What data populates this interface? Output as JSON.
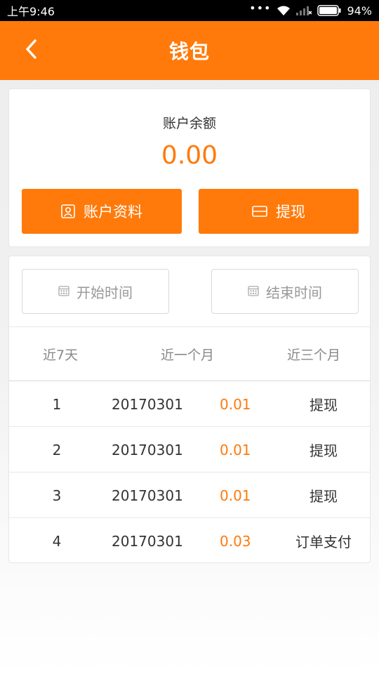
{
  "status_bar": {
    "time": "上午9:46",
    "battery": "94%",
    "icons": [
      "more-dots-icon",
      "wifi-icon",
      "signal-icon",
      "battery-icon"
    ]
  },
  "header": {
    "title": "钱包",
    "back_icon": "chevron-left-icon"
  },
  "balance": {
    "label": "账户余额",
    "value": "0.00"
  },
  "actions": {
    "profile_label": "账户资料",
    "profile_icon": "user-card-icon",
    "withdraw_label": "提现",
    "withdraw_icon": "bank-card-icon"
  },
  "filters": {
    "start_label": "开始时间",
    "end_label": "结束时间",
    "calendar_icon": "calendar-icon",
    "ranges": [
      "近7天",
      "近一个月",
      "近三个月"
    ]
  },
  "records": [
    {
      "index": "1",
      "date": "20170301",
      "amount": "0.01",
      "type": "提现"
    },
    {
      "index": "2",
      "date": "20170301",
      "amount": "0.01",
      "type": "提现"
    },
    {
      "index": "3",
      "date": "20170301",
      "amount": "0.01",
      "type": "提现"
    },
    {
      "index": "4",
      "date": "20170301",
      "amount": "0.03",
      "type": "订单支付"
    }
  ],
  "colors": {
    "accent": "#ff7a0a",
    "status_bar": "#000000",
    "background": "#f2f2f2"
  }
}
